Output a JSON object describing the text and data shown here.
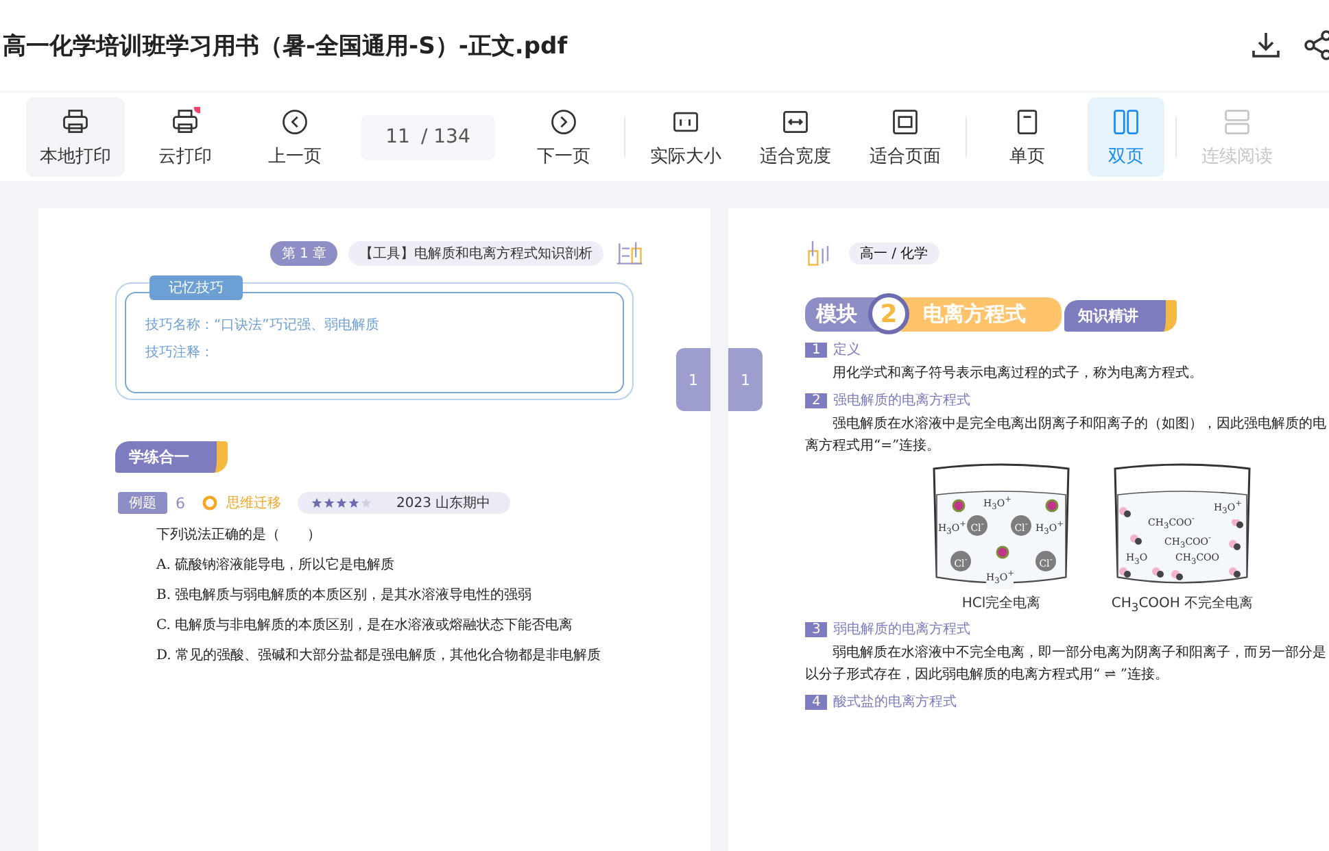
{
  "document": {
    "title": "高一化学培训班学习用书（暑-全国通用-S）-正文.pdf"
  },
  "title_actions": [
    {
      "kind": "download"
    },
    {
      "kind": "share"
    }
  ],
  "toolbar": [
    {
      "kind": "print",
      "label": "本地打印",
      "selected": false,
      "hovered": true,
      "disabled": false,
      "badge": false
    },
    {
      "kind": "cloud_print",
      "label": "云打印",
      "selected": false,
      "hovered": false,
      "disabled": false,
      "badge": true
    },
    {
      "kind": "prev",
      "label": "上一页",
      "selected": false,
      "hovered": false,
      "disabled": false,
      "badge": false
    },
    {
      "kind": "page_field",
      "value": "11",
      "total": "/ 134"
    },
    {
      "kind": "next",
      "label": "下一页",
      "selected": false,
      "hovered": false,
      "disabled": false,
      "badge": false
    },
    {
      "kind": "separator"
    },
    {
      "kind": "actual_size",
      "label": "实际大小",
      "selected": false,
      "hovered": false,
      "disabled": false,
      "badge": false
    },
    {
      "kind": "fit_width",
      "label": "适合宽度",
      "selected": false,
      "hovered": false,
      "disabled": false,
      "badge": false
    },
    {
      "kind": "fit_page",
      "label": "适合页面",
      "selected": false,
      "hovered": false,
      "disabled": false,
      "badge": false
    },
    {
      "kind": "separator"
    },
    {
      "kind": "single",
      "label": "单页",
      "selected": false,
      "hovered": false,
      "disabled": false,
      "badge": false
    },
    {
      "kind": "double",
      "label": "双页",
      "selected": true,
      "hovered": false,
      "disabled": false,
      "badge": false
    },
    {
      "kind": "separator"
    },
    {
      "kind": "continuous",
      "label": "连续阅读",
      "selected": false,
      "hovered": false,
      "disabled": true,
      "badge": false
    }
  ],
  "left_page": {
    "chapter": "第 1 章",
    "header": "【工具】电解质和电离方程式知识剖析",
    "tip_box": {
      "title": "记忆技巧",
      "lines": [
        "技巧名称：“口诀法”巧记强、弱电解质",
        "技巧注释："
      ]
    },
    "section_banner": "学练合一",
    "example": {
      "tag": "例题",
      "number": "6",
      "badge": "思维迁移",
      "stars": 4,
      "source": "2023 山东期中",
      "question": "下列说法正确的是（　　）",
      "options": [
        "A. 硫酸钠溶液能导电，所以它是电解质",
        "B. 强电解质与弱电解质的本质区别，是其水溶液导电性的强弱",
        "C. 电解质与非电解质的本质区别，是在水溶液或熔融状态下能否电离",
        "D. 常见的强酸、强碱和大部分盐都是强电解质，其他化合物都是非电解质"
      ]
    },
    "page_tab": "1"
  },
  "right_page": {
    "crumb": "高一 / 化学",
    "page_tab": "1",
    "module": {
      "label": "模块",
      "number": "2",
      "title": "电离方程式"
    },
    "section_banner": "知识精讲",
    "sections": [
      {
        "number": "1",
        "heading": "定义",
        "paragraphs": [
          "用化学式和离子符号表示电离过程的式子，称为电离方程式。"
        ]
      },
      {
        "number": "2",
        "heading": "强电解质的电离方程式",
        "paragraphs": [
          "强电解质在水溶液中是完全电离出阴离子和阳离子的（如图），因此强电解质的电离方程式用“=”连接。"
        ],
        "figure": [
          {
            "kind": "strong",
            "caption": "HCl完全电离",
            "labels": [
              "H$_{3}$O$^{+}$",
              "H$_{3}$O$^{+}$",
              "Cl$^{-}$",
              "Cl$^{-}$",
              "H$_{3}$O$^{+}$",
              "Cl$^{-}$",
              "Cl$^{-}$",
              "H$_{3}$O$^{+}$"
            ]
          },
          {
            "kind": "weak",
            "caption": "CH$_{3}$COOH 不完全电离",
            "labels": [
              "H$_{3}$O$^{+}$",
              "CH$_{3}$COO$^{-}$",
              "CH$_{3}$COO$^{-}$",
              "H$_{3}$O",
              "CH$_{3}$COO"
            ]
          }
        ]
      },
      {
        "number": "3",
        "heading": "弱电解质的电离方程式",
        "paragraphs": [
          "弱电解质在水溶液中不完全电离，即一部分电离为阴离子和阳离子，而另一部分是以分子形式存在，因此弱电解质的电离方程式用“ ⇌ ”连接。"
        ]
      },
      {
        "number": "4",
        "heading": "酸式盐的电离方程式"
      }
    ]
  }
}
